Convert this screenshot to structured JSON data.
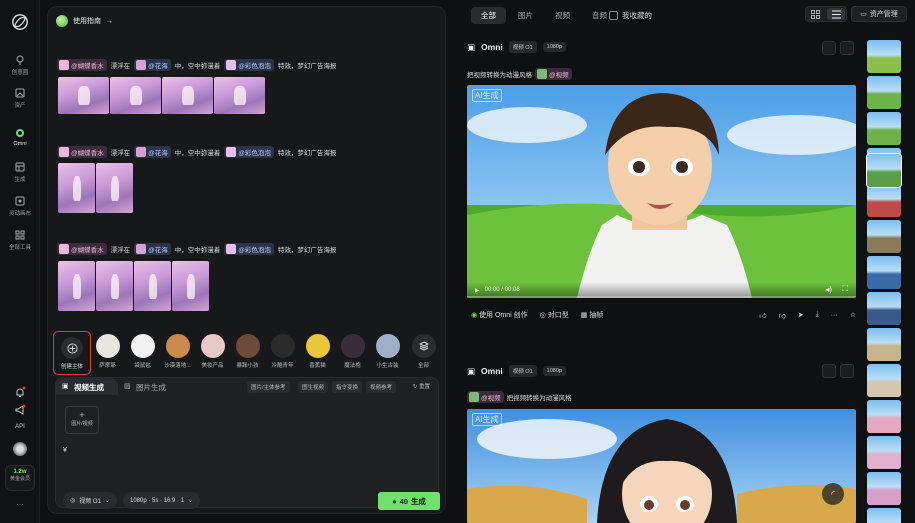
{
  "nav": {
    "items": [
      {
        "label": "创意圈"
      },
      {
        "label": "资产"
      },
      {
        "label": "Omni"
      },
      {
        "label": "生成"
      },
      {
        "label": "灵动画布"
      },
      {
        "label": "全部工具"
      }
    ],
    "api_label": "API",
    "member": {
      "count": "1.2w",
      "label": "黄金会员"
    },
    "more": "···"
  },
  "center": {
    "guide_label": "使用指南",
    "guide_arrow": "→",
    "prompts": [
      {
        "tag1": "@蝴蝶香水",
        "t1": "漂浮在",
        "tag2": "@花海",
        "t2": "中，空中弥漫着",
        "tag3": "@彩色泡泡",
        "t3": "特效，梦幻广告海报"
      },
      {
        "tag1": "@蝴蝶香水",
        "t1": "漂浮在",
        "tag2": "@花海",
        "t2": "中，空中弥漫着",
        "tag3": "@彩色泡泡",
        "t3": "特效，梦幻广告海报"
      },
      {
        "tag1": "@蝴蝶香水",
        "t1": "漂浮在",
        "tag2": "@花海",
        "t2": "中，空中弥漫着",
        "tag3": "@彩色泡泡",
        "t3": "特效，梦幻广告海报"
      }
    ],
    "create_subject": "创建主体",
    "subjects": [
      {
        "label": "萨摩耶",
        "color": "#e9e6e0"
      },
      {
        "label": "袋鼠包",
        "color": "#f2f2f2"
      },
      {
        "label": "沙漠落地...",
        "color": "#c98a4b"
      },
      {
        "label": "美妆产品",
        "color": "#e8c9c6"
      },
      {
        "label": "暴躁小孩",
        "color": "#6b4a3a"
      },
      {
        "label": "冷酷青年",
        "color": "#2a2a2a"
      },
      {
        "label": "香蕉猫",
        "color": "#e8c83a"
      },
      {
        "label": "魔法袍",
        "color": "#3a2d3a"
      },
      {
        "label": "小生古装",
        "color": "#9fb0c8"
      }
    ],
    "all_label": "全部"
  },
  "composer": {
    "tabs": [
      "视频生成",
      "图片生成"
    ],
    "chips": [
      "图片/主体参考",
      "图生视频",
      "指令变换",
      "视频参考"
    ],
    "reset": "重置",
    "add_label": "图片/视频",
    "input_value": "¥",
    "model_select": "视频 O1",
    "params_select": "1080p · 5s · 16:9 · 1",
    "gen_cost": "40",
    "gen_label": "生成"
  },
  "right": {
    "filters": [
      "全部",
      "图片",
      "视频",
      "音频"
    ],
    "fav_label": "我收藏的",
    "assets_label": "资产管理",
    "cards": [
      {
        "title": "Omni",
        "pills": [
          "视频 O1",
          "1080p"
        ],
        "caption_pre": "把视频转换为动漫风格",
        "caption_tag": "@视频",
        "caption_post": "",
        "ai_label": "AI生成",
        "time": "00:00 / 00:08"
      },
      {
        "title": "Omni",
        "pills": [
          "视频 O1",
          "1080p"
        ],
        "caption_pre": "",
        "caption_tag": "@视频",
        "caption_post": "把视频转换为动漫风格",
        "ai_label": "AI生成"
      }
    ],
    "actions": {
      "use": "使用 Omni 创作",
      "lipsync": "对口型",
      "frame": "抽帧",
      "more": "···"
    }
  }
}
